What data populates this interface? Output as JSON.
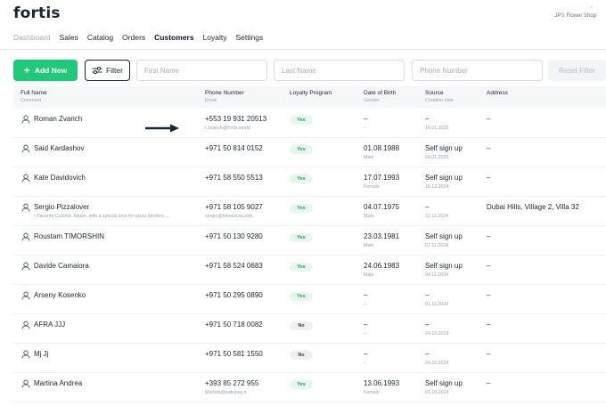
{
  "app": {
    "logo": "fortis",
    "shop_name": "JP's Flower Shop",
    "shop_caret": "⌃"
  },
  "nav": [
    {
      "label": "Dashboard",
      "state": "dim"
    },
    {
      "label": "Sales",
      "state": ""
    },
    {
      "label": "Catalog",
      "state": ""
    },
    {
      "label": "Orders",
      "state": ""
    },
    {
      "label": "Customers",
      "state": "active"
    },
    {
      "label": "Loyalty",
      "state": ""
    },
    {
      "label": "Settings",
      "state": ""
    }
  ],
  "toolbar": {
    "add_label": "Add New",
    "filter_label": "Filter",
    "first_name_placeholder": "First Name",
    "last_name_placeholder": "Last Name",
    "phone_placeholder": "Phone Number",
    "reset_label": "Reset Filter"
  },
  "table": {
    "columns": [
      {
        "label": "Full Name",
        "sub": "Comment"
      },
      {
        "label": "Phone Number",
        "sub": "Email"
      },
      {
        "label": "Loyalty Program",
        "sub": ""
      },
      {
        "label": "Date of Birth",
        "sub": "Gender"
      },
      {
        "label": "Source",
        "sub": "Creation date"
      },
      {
        "label": "Address",
        "sub": ""
      }
    ],
    "rows": [
      {
        "name": "Roman Zvarich",
        "comment": "",
        "phone": "+553 19 931 20513",
        "email": "r.zvarich@fortis.world",
        "loyalty": "Yes",
        "dob": "–",
        "gender": "–",
        "source": "–",
        "created": "16.01.2025",
        "address": "–"
      },
      {
        "name": "Said Kardashov",
        "comment": "",
        "phone": "+971 50 814 0152",
        "email": "",
        "loyalty": "Yes",
        "dob": "01.08.1988",
        "gender": "Male",
        "source": "Self sign up",
        "created": "08.01.2025",
        "address": "–"
      },
      {
        "name": "Kate Davidovich",
        "comment": "",
        "phone": "+971 58 550 5513",
        "email": "",
        "loyalty": "Yes",
        "dob": "17.07.1993",
        "gender": "Female",
        "source": "Self sign up",
        "created": "16.12.2024",
        "address": "–"
      },
      {
        "name": "Sergio Pizzalover",
        "comment": "• Favorite Cuisine: Italian, with a special love for pizza (prefers ...",
        "phone": "+971 58 105 9027",
        "email": "sergio@lovepizza.com",
        "loyalty": "Yes",
        "dob": "04.07.1975",
        "gender": "Male",
        "source": "–",
        "created": "12.11.2024",
        "address": "Dubai Hills, Village 2, Villa 32"
      },
      {
        "name": "Roustam TIMORSHIN",
        "comment": "",
        "phone": "+971 50 130 9280",
        "email": "",
        "loyalty": "Yes",
        "dob": "23.03.1981",
        "gender": "Male",
        "source": "Self sign up",
        "created": "07.11.2024",
        "address": "–"
      },
      {
        "name": "Davide Camaiora",
        "comment": "",
        "phone": "+971 58 524 0683",
        "email": "",
        "loyalty": "Yes",
        "dob": "24.06.1983",
        "gender": "Male",
        "source": "Self sign up",
        "created": "04.11.2024",
        "address": "–"
      },
      {
        "name": "Arseny Kosenko",
        "comment": "",
        "phone": "+971 50 295 0890",
        "email": "",
        "loyalty": "Yes",
        "dob": "–",
        "gender": "–",
        "source": "–",
        "created": "01.11.2024",
        "address": "–"
      },
      {
        "name": "AFRA JJJ",
        "comment": "",
        "phone": "+971 50 718 0082",
        "email": "",
        "loyalty": "No",
        "dob": "–",
        "gender": "–",
        "source": "–",
        "created": "24.10.2024",
        "address": "–"
      },
      {
        "name": "Mj Jj",
        "comment": "",
        "phone": "+971 50 581 1550",
        "email": "",
        "loyalty": "No",
        "dob": "–",
        "gender": "–",
        "source": "–",
        "created": "24.10.2024",
        "address": "–"
      },
      {
        "name": "Martina Andrea",
        "comment": "",
        "phone": "+393 85 272 955",
        "email": "Martina@satispay.it",
        "loyalty": "Yes",
        "dob": "13.06.1993",
        "gender": "Female",
        "source": "Self sign up",
        "created": "01.10.2024",
        "address": "–"
      }
    ]
  },
  "colors": {
    "accent": "#1ec97a",
    "text": "#1f2530",
    "muted": "#9aa2ad",
    "yes_bg": "#e6f7ee",
    "yes_text": "#1a9e5c"
  }
}
